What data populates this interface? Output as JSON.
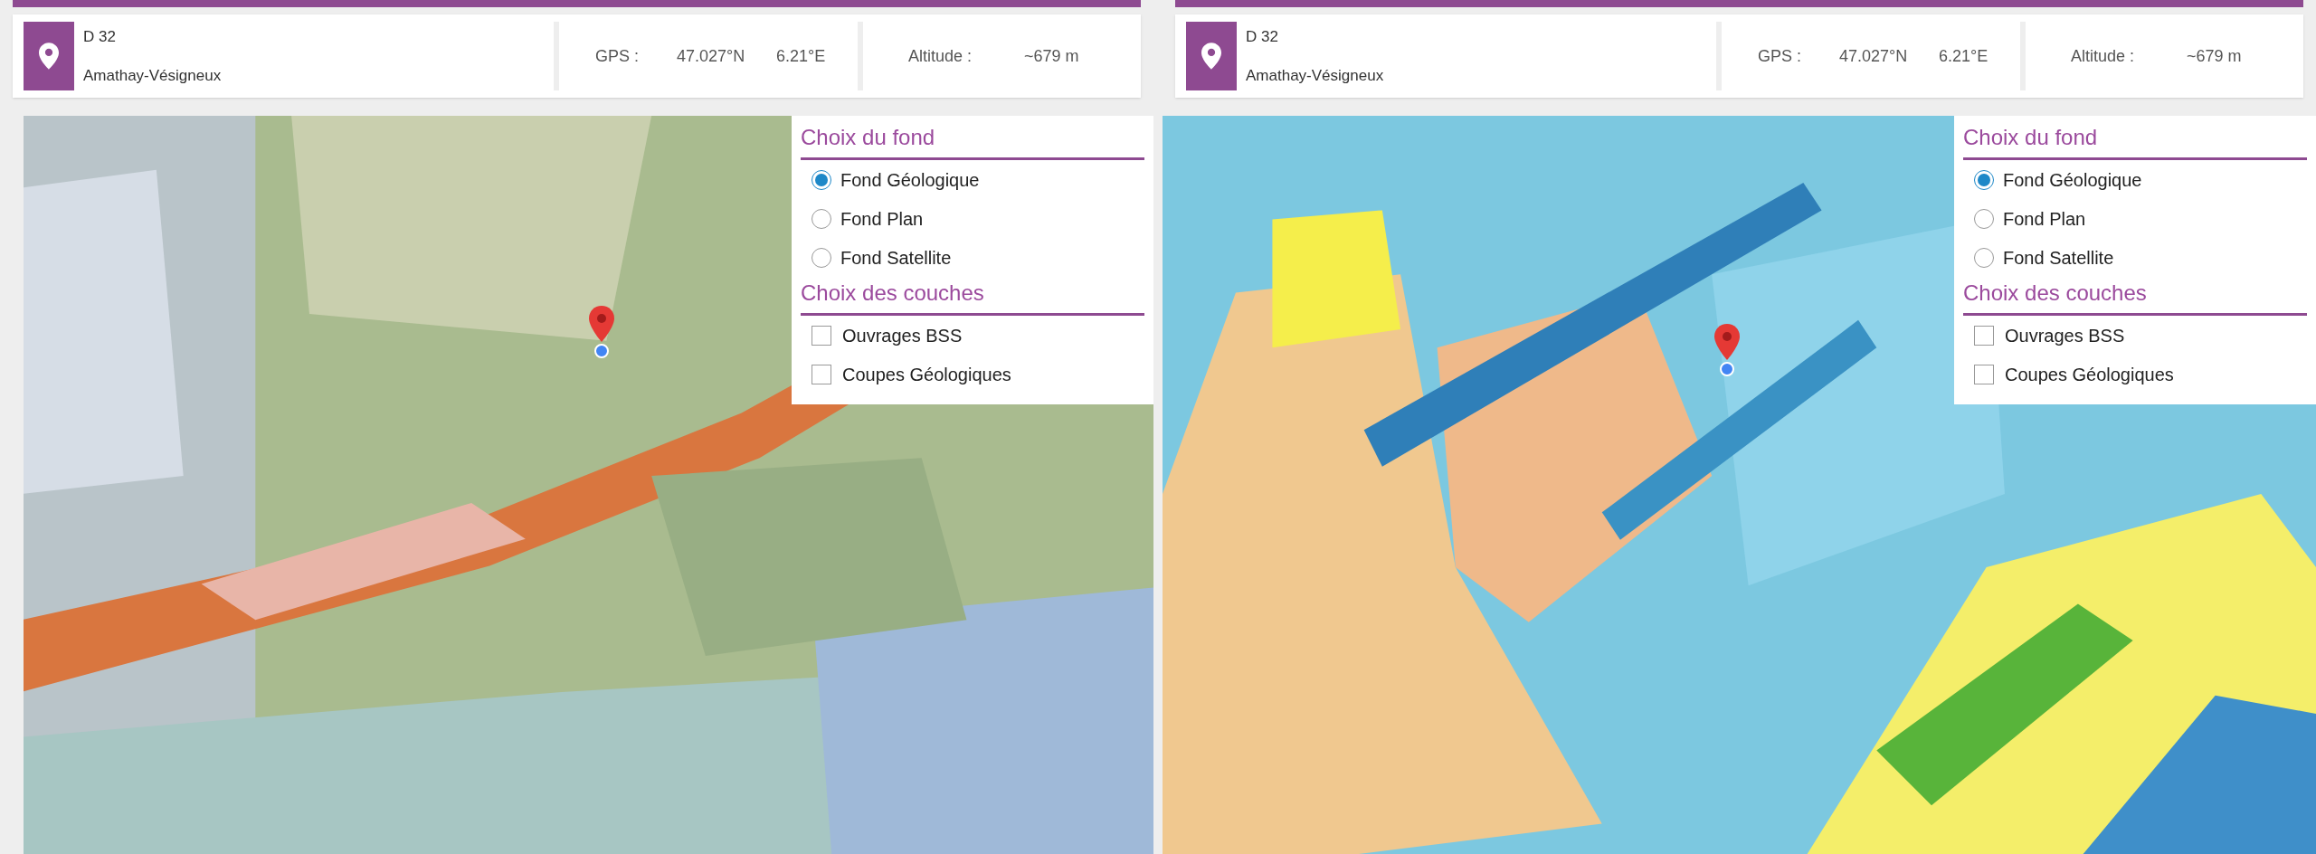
{
  "panels": [
    {
      "header": {
        "road": "D 32",
        "place": "Amathay-Vésigneux",
        "gps_label": "GPS :",
        "latitude": "47.027°N",
        "longitude": "6.21°E",
        "altitude_label": "Altitude :",
        "altitude": "~679 m"
      },
      "layer_control": {
        "base_title": "Choix du fond",
        "base_options": [
          {
            "label": "Fond Géologique",
            "selected": true
          },
          {
            "label": "Fond Plan",
            "selected": false
          },
          {
            "label": "Fond Satellite",
            "selected": false
          }
        ],
        "layers_title": "Choix des couches",
        "layers": [
          {
            "label": "Ouvrages BSS",
            "checked": false
          },
          {
            "label": "Coupes Géologiques",
            "checked": false
          }
        ]
      }
    },
    {
      "header": {
        "road": "D 32",
        "place": "Amathay-Vésigneux",
        "gps_label": "GPS :",
        "latitude": "47.027°N",
        "longitude": "6.21°E",
        "altitude_label": "Altitude :",
        "altitude": "~679 m"
      },
      "layer_control": {
        "base_title": "Choix du fond",
        "base_options": [
          {
            "label": "Fond Géologique",
            "selected": true
          },
          {
            "label": "Fond Plan",
            "selected": false
          },
          {
            "label": "Fond Satellite",
            "selected": false
          }
        ],
        "layers_title": "Choix des couches",
        "layers": [
          {
            "label": "Ouvrages BSS",
            "checked": false
          },
          {
            "label": "Coupes Géologiques",
            "checked": false
          }
        ]
      }
    }
  ]
}
